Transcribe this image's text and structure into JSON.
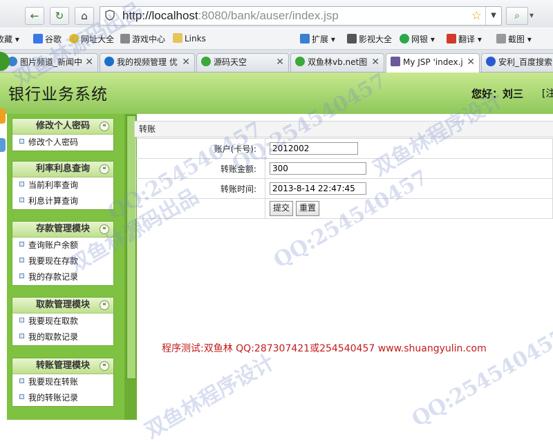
{
  "browser": {
    "url_host": "http://localhost",
    "url_path": ":8080/bank/auser/index.jsp",
    "bookmarks": [
      "收藏",
      "谷歌",
      "网址大全",
      "游戏中心",
      "Links",
      "扩展",
      "影视大全",
      "网银",
      "翻译",
      "截图"
    ],
    "tabs": [
      {
        "label": "图片频道_新闻中",
        "active": false,
        "color": "#3a7fd0"
      },
      {
        "label": "我的视频管理 优",
        "active": false,
        "color": "#1a6fc8"
      },
      {
        "label": "源码天空",
        "active": false,
        "color": "#3aa83a"
      },
      {
        "label": "双鱼林vb.net图",
        "active": false,
        "color": "#3aa83a"
      },
      {
        "label": "My JSP 'index.j",
        "active": true,
        "color": "#6a5a9a"
      },
      {
        "label": "安利_百度搜索",
        "active": false,
        "color": "#2a5ad0"
      }
    ]
  },
  "site": {
    "title": "银行业务系统",
    "greeting": "您好：刘三",
    "greeting_extra": "[注"
  },
  "sidebar": {
    "menus": [
      {
        "title": "修改个人密码",
        "items": [
          "修改个人密码"
        ]
      },
      {
        "title": "利率利息查询",
        "items": [
          "当前利率查询",
          "利息计算查询"
        ]
      },
      {
        "title": "存款管理模块",
        "items": [
          "查询账户余额",
          "我要现在存款",
          "我的存款记录"
        ]
      },
      {
        "title": "取款管理模块",
        "items": [
          "我要现在取款",
          "我的取款记录"
        ]
      },
      {
        "title": "转账管理模块",
        "items": [
          "我要现在转账",
          "我的转账记录"
        ]
      }
    ]
  },
  "form": {
    "title": "转账",
    "account_label": "账户(卡号):",
    "account_value": "2012002",
    "amount_label": "转账金额:",
    "amount_value": "300",
    "time_label": "转账时间:",
    "time_value": "2013-8-14 22:47:45",
    "submit_label": "提交",
    "reset_label": "重置"
  },
  "credit": "程序测试:双鱼林 QQ:287307421或254540457 www.shuangyulin.com",
  "watermarks": [
    "双鱼林源码出品",
    "QQ:254540457",
    "双鱼林程序设计",
    "双鱼林源码出品",
    "QQ:254540457",
    "双鱼林程序设计",
    "QQ:254540457",
    "QQ:254540457"
  ]
}
